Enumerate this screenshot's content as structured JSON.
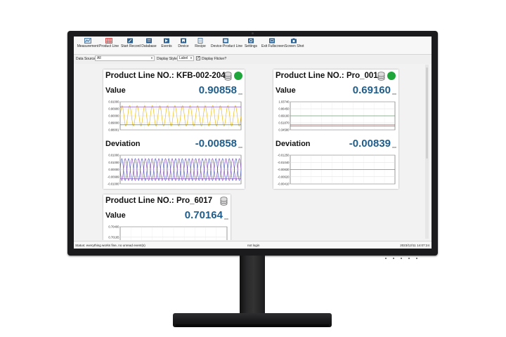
{
  "toolbar": {
    "items": [
      {
        "label": "Measurement",
        "icon": "measurement-icon"
      },
      {
        "label": "Product Line",
        "icon": "product-line-icon"
      },
      {
        "label": "Start Record",
        "icon": "start-record-icon"
      },
      {
        "label": "Database",
        "icon": "database-icon"
      },
      {
        "label": "Events",
        "icon": "events-icon"
      },
      {
        "label": "Device",
        "icon": "device-icon"
      },
      {
        "label": "Recipe",
        "icon": "recipe-icon"
      },
      {
        "label": "Device-Product Line",
        "icon": "device-product-line-icon"
      },
      {
        "label": "Settings",
        "icon": "settings-icon"
      },
      {
        "label": "Exit Fullscreen",
        "icon": "exit-fullscreen-icon"
      },
      {
        "label": "Screen Shot",
        "icon": "camera-icon"
      }
    ]
  },
  "filter": {
    "data_source_label": "Data Source",
    "data_source_value": "All",
    "display_style_label": "Display Style",
    "display_style_value": "Label",
    "display_flicker_label": "Display Flicker?",
    "display_flicker_checked": true
  },
  "cards": [
    {
      "title": "Product Line NO.: KFB-002-204",
      "status_color": "#1fa63a",
      "value_label": "Value",
      "value": "0.90858",
      "value_unit": "mm",
      "deviation_label": "Deviation",
      "deviation": "-0.00858",
      "deviation_unit": "mm"
    },
    {
      "title": "Product Line NO.: Pro_001",
      "status_color": "#1fa63a",
      "value_label": "Value",
      "value": "0.69160",
      "value_unit": "mm",
      "deviation_label": "Deviation",
      "deviation": "-0.00839",
      "deviation_unit": "mm"
    },
    {
      "title": "Product Line NO.: Pro_6017",
      "value_label": "Value",
      "value": "0.70164",
      "value_unit": "mm"
    }
  ],
  "chart_data": [
    {
      "type": "line",
      "yticks": [
        "0.91000",
        "0.90900",
        "0.90000",
        "0.89000",
        "0.88001"
      ],
      "series": [
        {
          "color": "#e8b400",
          "style": "sine",
          "cycles": 16,
          "amplitude": 0.36,
          "baseline": 0.5
        },
        {
          "color": "#7a3fb0",
          "style": "flat",
          "level": 0.82
        },
        {
          "color": "#2e7d32",
          "style": "flat",
          "level": 0.18
        }
      ]
    },
    {
      "type": "line",
      "yticks": [
        "0.01000",
        "0.01000",
        "0.00000",
        "-0.00999",
        "-0.01000"
      ],
      "series": [
        {
          "color": "#3f51b5",
          "style": "sine",
          "cycles": 18,
          "amplitude": 0.38,
          "baseline": 0.5
        },
        {
          "color": "#7a3fb0",
          "style": "sine",
          "cycles": 18,
          "amplitude": 0.38,
          "baseline": 0.5,
          "phase": 0.5
        },
        {
          "color": "#7a3fb0",
          "style": "flat",
          "level": 0.18
        }
      ]
    },
    {
      "type": "line",
      "yticks": [
        "1.03740",
        "0.86450",
        "0.69160",
        "0.51870",
        "0.34580"
      ],
      "series": [
        {
          "color": "#2e7d32",
          "style": "flat",
          "level": 0.5
        },
        {
          "color": "#e53935",
          "style": "flat",
          "level": 0.18
        },
        {
          "color": "#7a3fb0",
          "style": "flat",
          "level": 0.14
        }
      ]
    },
    {
      "type": "line",
      "yticks": [
        "-0.01250",
        "-0.01040",
        "-0.00830",
        "-0.00620",
        "-0.00410"
      ],
      "series": [
        {
          "color": "#3f51b5",
          "style": "flat",
          "level": 0.5
        }
      ]
    },
    {
      "type": "line",
      "yticks": [
        "0.70400",
        "0.70165"
      ],
      "series": [
        {
          "color": "#e8b400",
          "style": "spikes",
          "cycles": 6
        }
      ]
    }
  ],
  "statusbar": {
    "message": "Status: everything works fine, no unread event(s)",
    "login": "not login",
    "datetime": "2023/12/11 14:07:24"
  }
}
